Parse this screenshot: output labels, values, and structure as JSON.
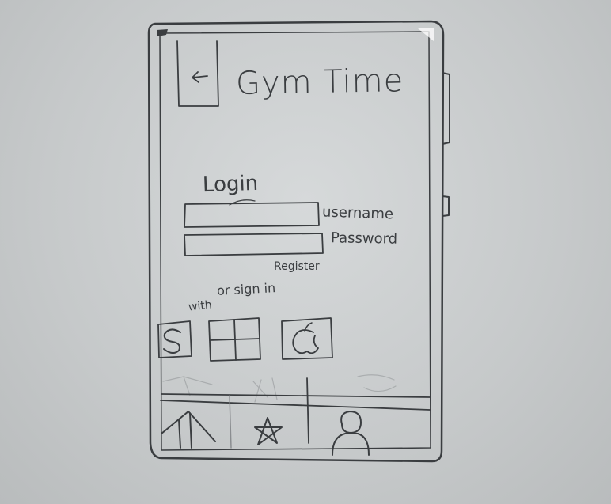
{
  "header": {
    "back_icon": "back-arrow-icon",
    "title": "Gym Time"
  },
  "login": {
    "heading": "Login",
    "username_label": "username",
    "password_label": "Password",
    "register_label": "Register"
  },
  "social": {
    "prompt": "or sign in",
    "prompt_with": "with",
    "providers": [
      {
        "icon": "skype-icon"
      },
      {
        "icon": "windows-icon"
      },
      {
        "icon": "apple-icon"
      }
    ]
  },
  "bottom_nav": {
    "items": [
      {
        "icon": "home-icon"
      },
      {
        "icon": "star-icon"
      },
      {
        "icon": "profile-icon"
      }
    ]
  },
  "colors": {
    "ink": "#3a3d40",
    "paper": "#c9cccd"
  }
}
